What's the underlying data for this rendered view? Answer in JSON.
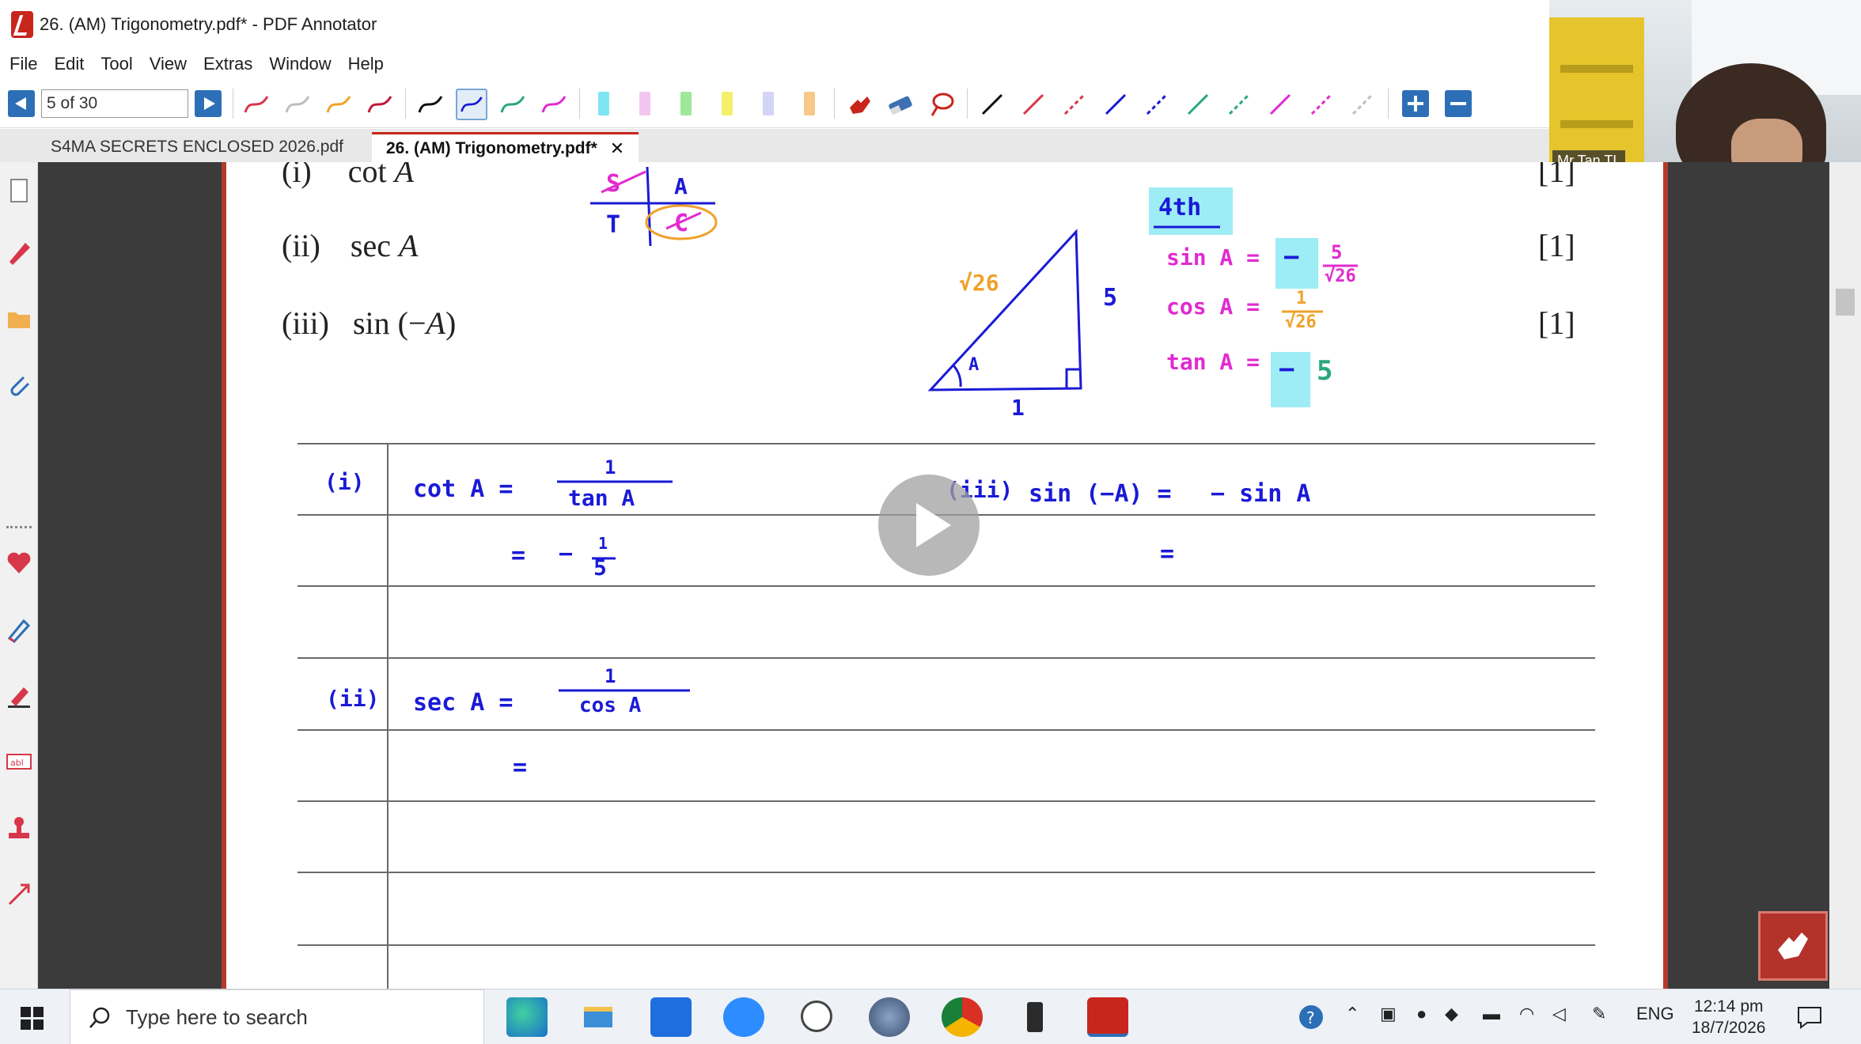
{
  "window": {
    "title": "26. (AM) Trigonometry.pdf* - PDF Annotator"
  },
  "menu": [
    "File",
    "Edit",
    "Tool",
    "View",
    "Extras",
    "Window",
    "Help"
  ],
  "toolbar": {
    "page_field": "5 of 30"
  },
  "tabs": [
    {
      "label": "S4MA SECRETS ENCLOSED 2026.pdf",
      "active": false
    },
    {
      "label": "26. (AM) Trigonometry.pdf*",
      "active": true,
      "close": "✕"
    }
  ],
  "webcam": {
    "label": "Mr Tan TL"
  },
  "document": {
    "questions": [
      {
        "num": "(i)",
        "expr_pre": "cot ",
        "expr_var": "A",
        "marks": "[1]"
      },
      {
        "num": "(ii)",
        "expr_pre": "sec ",
        "expr_var": "A",
        "marks": "[1]"
      },
      {
        "num": "(iii)",
        "expr_pre": "sin  (−",
        "expr_var": "A",
        "expr_post": ")",
        "marks": "[1]"
      }
    ],
    "quadrant": {
      "s": "S",
      "a": "A",
      "t": "T",
      "c": "C"
    },
    "triangle": {
      "hyp": "√26",
      "opp": "5",
      "adj": "1",
      "angle": "A"
    },
    "info": {
      "quadrant_note": "4th",
      "sin": {
        "label": "sin A =",
        "sign": "−",
        "num": "5",
        "den": "√26"
      },
      "cos": {
        "label": "cos A =",
        "num": "1",
        "den": "√26"
      },
      "tan": {
        "label": "tan A =",
        "sign": "−",
        "val": "5"
      }
    },
    "answers": {
      "i": {
        "tag": "(i)",
        "lhs": "cot A =",
        "num": "1",
        "den": "tan A",
        "eq": "=",
        "res_sign": "−",
        "res_num": "1",
        "res_den": "5"
      },
      "iii": {
        "tag": "(iii)",
        "lhs": "sin (−A) =",
        "rhs": "− sin A",
        "eq": "="
      },
      "ii": {
        "tag": "(ii)",
        "lhs": "sec A =",
        "num": "1",
        "den": "cos A",
        "eq": "="
      }
    }
  },
  "taskbar": {
    "search_placeholder": "Type here to search",
    "lang": "ENG",
    "time": "12:14 pm",
    "date": "18/7/2026"
  },
  "colors": {
    "ink_blue": "#1a1ad6",
    "ink_magenta": "#e12bd0",
    "ink_orange": "#f0a12a",
    "ink_green": "#2aa87a",
    "highlight_cyan": "#7ee6f2",
    "frame_red": "#b53a2a"
  }
}
